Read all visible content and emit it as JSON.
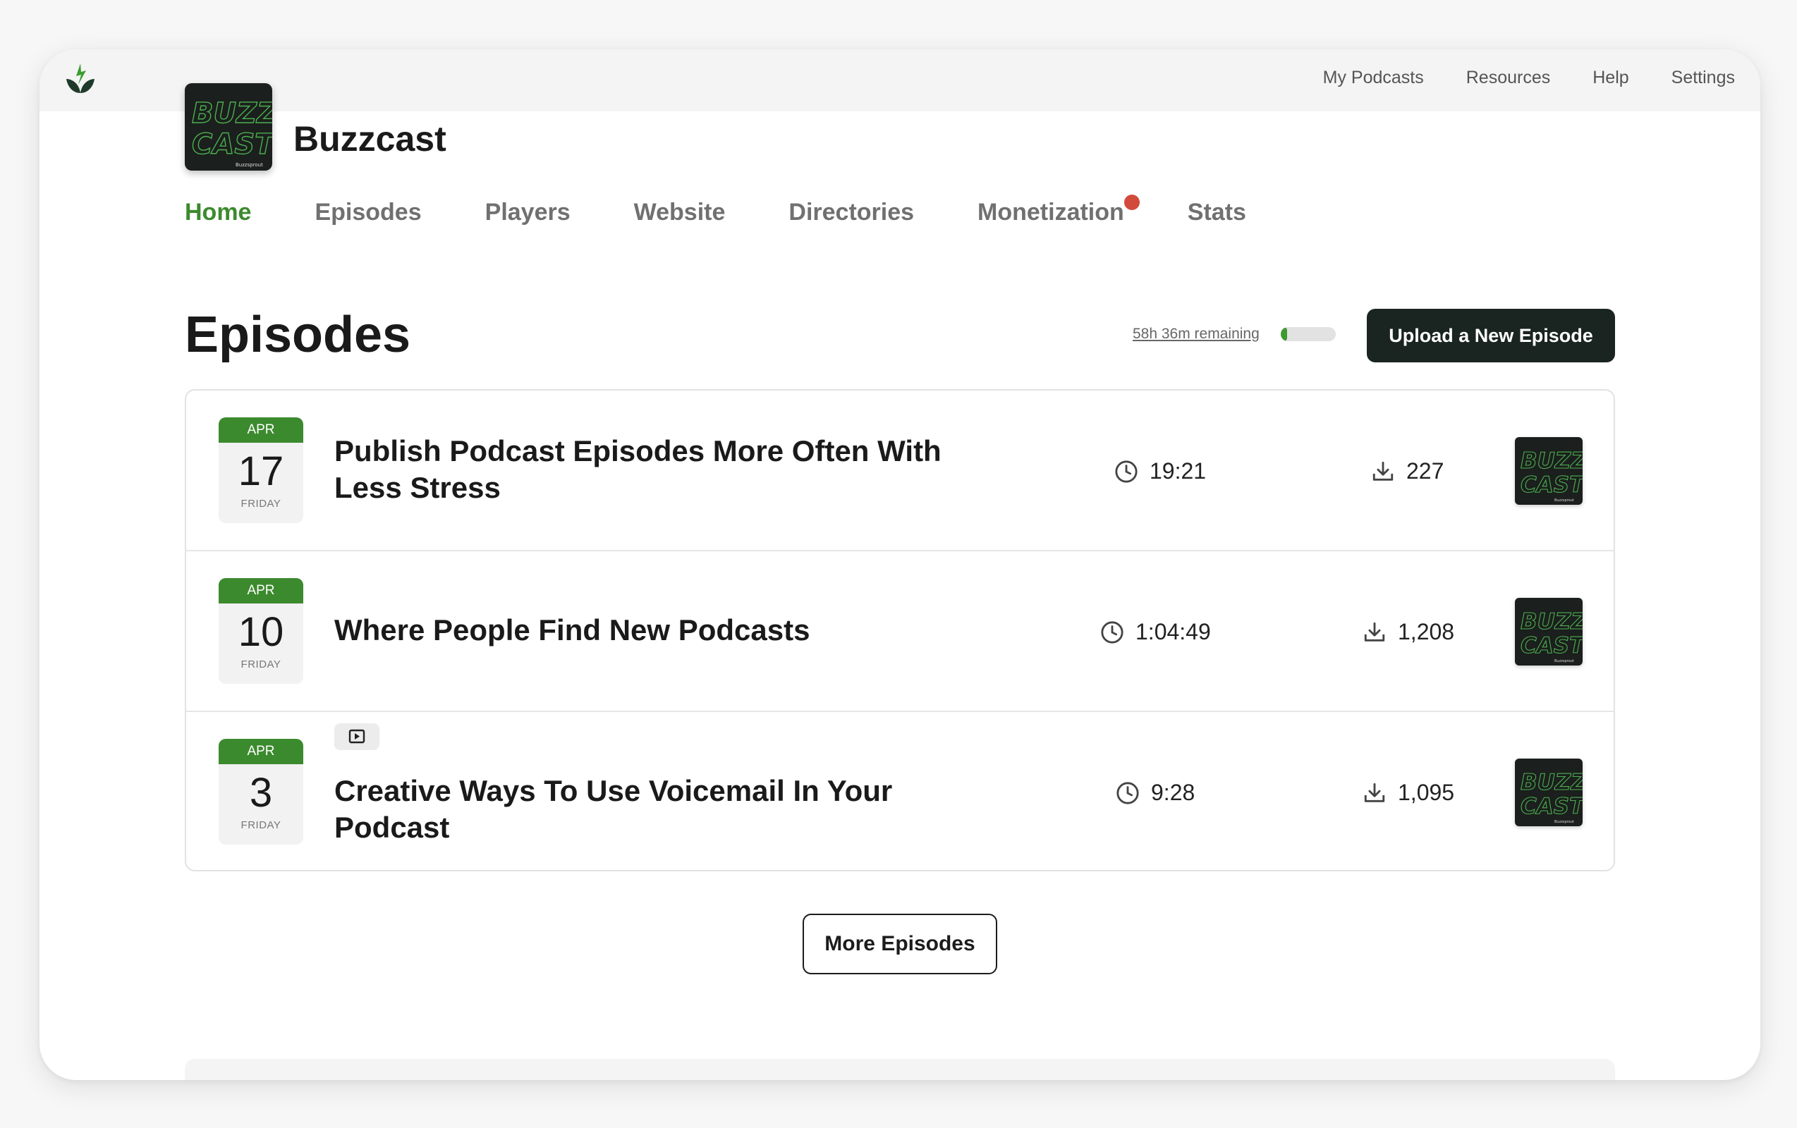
{
  "topnav": {
    "items": [
      "My Podcasts",
      "Resources",
      "Help",
      "Settings"
    ]
  },
  "podcast": {
    "title": "Buzzcast",
    "cover_text_1": "BUZZ",
    "cover_text_2": "CAST",
    "cover_brand": "Buzzsprout"
  },
  "mainnav": {
    "tabs": [
      "Home",
      "Episodes",
      "Players",
      "Website",
      "Directories",
      "Monetization",
      "Stats"
    ],
    "active": "Home"
  },
  "episodes_section": {
    "title": "Episodes",
    "remaining": "58h 36m remaining",
    "remaining_fraction": 0.08,
    "upload_label": "Upload a New Episode",
    "more_label": "More Episodes"
  },
  "episodes": [
    {
      "month": "APR",
      "day": "17",
      "weekday": "FRIDAY",
      "title": "Publish Podcast Episodes More Often With Less Stress",
      "duration": "19:21",
      "downloads": "227",
      "has_media_badge": false
    },
    {
      "month": "APR",
      "day": "10",
      "weekday": "FRIDAY",
      "title": "Where People Find New Podcasts",
      "duration": "1:04:49",
      "downloads": "1,208",
      "has_media_badge": false
    },
    {
      "month": "APR",
      "day": "3",
      "weekday": "FRIDAY",
      "title": "Creative Ways To Use Voicemail In Your Podcast",
      "duration": "9:28",
      "downloads": "1,095",
      "has_media_badge": true
    }
  ],
  "colors": {
    "accent": "#3c8a2e",
    "dark_button": "#1a2421",
    "notification": "#d24a3c"
  },
  "icons": {
    "logo": "buzzsprout-leaf-icon",
    "duration": "clock-icon",
    "downloads": "download-icon",
    "media": "play-video-icon"
  }
}
